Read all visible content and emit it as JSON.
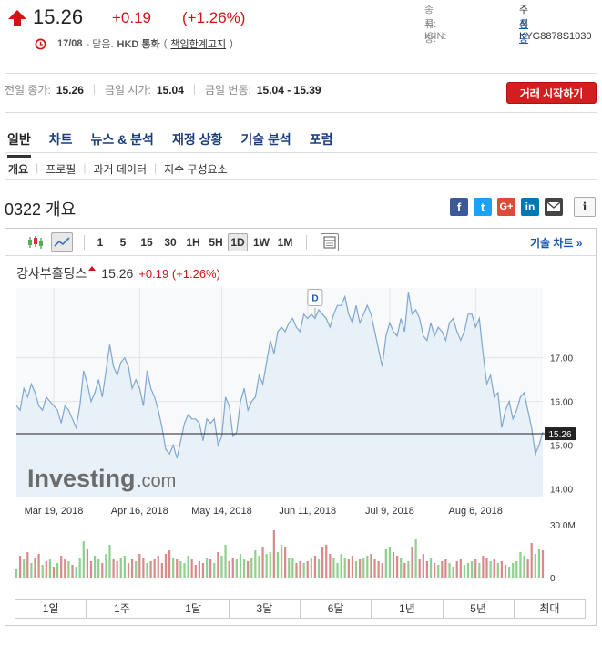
{
  "quote": {
    "price": "15.26",
    "change": "+0.19",
    "change_pct": "(+1.26%)",
    "date": "17/08",
    "status": "- 닫음.",
    "currency": "HKD 통화",
    "disclaimer": "책임한계고지",
    "disclaimer_open": "(",
    "disclaimer_close": ")"
  },
  "info": {
    "type_label": "종류:",
    "type_value": "주식",
    "market_label": "시장:",
    "market_value": "홍콩",
    "isin_label": "ISIN:",
    "isin_value": "KYG8878S1030"
  },
  "summary": {
    "prev_close_label": "전일 종가:",
    "prev_close": "15.26",
    "open_label": "금일 시가:",
    "open": "15.04",
    "range_label": "금일 변동:",
    "range": "15.04 - 15.39"
  },
  "trade_button": "거래 시작하기",
  "tabs": [
    "일반",
    "차트",
    "뉴스 & 분석",
    "재정 상황",
    "기술 분석",
    "포럼"
  ],
  "subtabs": [
    "개요",
    "프로필",
    "과거 데이터",
    "지수 구성요소"
  ],
  "section_title": "0322 개요",
  "share": {
    "fb": "f",
    "tw": "t",
    "gp": "G+",
    "li": "in",
    "info": "i"
  },
  "toolbar": {
    "intervals": [
      "1",
      "5",
      "15",
      "30",
      "1H",
      "5H",
      "1D",
      "1W",
      "1M"
    ],
    "selected": "1D",
    "tech_link": "기술 차트 »"
  },
  "chart_title": {
    "name": "강사부홀딩스",
    "price": "15.26",
    "change": "+0.19 (+1.26%)"
  },
  "watermark": {
    "brand": "Investing",
    "suffix": ".com"
  },
  "marker": "D",
  "ranges": [
    "1일",
    "1주",
    "1달",
    "3달",
    "6달",
    "1년",
    "5년",
    "최대"
  ],
  "chart_data": {
    "type": "area",
    "title": "강사부홀딩스",
    "last_value": 15.26,
    "y_ticks": [
      17.0,
      16.0,
      15.0,
      14.0
    ],
    "y_tick_labels": [
      "17.00",
      "16.00",
      "15.00",
      "14.00"
    ],
    "ylim": [
      13.8,
      18.6
    ],
    "x_labels": [
      "Mar 19, 2018",
      "Apr 16, 2018",
      "May 14, 2018",
      "Jun 11, 2018",
      "Jul 9, 2018",
      "Aug 6, 2018"
    ],
    "values": [
      15.9,
      15.8,
      16.3,
      16.1,
      16.4,
      16.2,
      15.9,
      15.8,
      16.1,
      16.0,
      15.9,
      15.8,
      15.5,
      15.9,
      15.8,
      15.6,
      15.4,
      15.9,
      16.7,
      16.4,
      16.0,
      16.2,
      16.5,
      16.1,
      16.7,
      17.3,
      16.8,
      16.6,
      16.9,
      17.0,
      16.8,
      16.3,
      16.5,
      16.3,
      15.9,
      16.7,
      16.3,
      16.1,
      15.8,
      15.4,
      14.9,
      14.8,
      15.0,
      14.7,
      15.1,
      15.5,
      15.7,
      15.6,
      15.6,
      15.5,
      15.1,
      15.6,
      15.5,
      15.6,
      15.0,
      15.2,
      16.1,
      15.9,
      15.2,
      15.3,
      16.0,
      16.3,
      15.8,
      16.0,
      16.1,
      16.6,
      16.4,
      16.9,
      17.4,
      17.1,
      17.6,
      17.7,
      17.6,
      17.8,
      17.9,
      17.7,
      17.6,
      18.0,
      17.9,
      18.0,
      17.9,
      18.1,
      18.0,
      17.9,
      17.7,
      18.0,
      18.2,
      18.2,
      18.4,
      18.0,
      17.8,
      18.2,
      17.8,
      18.0,
      18.2,
      18.0,
      17.6,
      17.2,
      16.8,
      17.5,
      17.8,
      17.6,
      17.5,
      17.9,
      17.6,
      18.5,
      18.0,
      18.1,
      17.9,
      17.5,
      17.4,
      17.8,
      17.5,
      17.7,
      17.6,
      17.4,
      17.8,
      17.9,
      17.6,
      17.4,
      17.6,
      18.0,
      18.0,
      17.7,
      17.9,
      17.1,
      16.4,
      16.6,
      16.1,
      16.2,
      15.4,
      15.8,
      16.0,
      15.6,
      15.8,
      16.1,
      16.2,
      15.8,
      15.4,
      14.8,
      15.0,
      15.3
    ],
    "volume_label": "30.0M",
    "volume_zero": "0",
    "volume": [
      5,
      12,
      10,
      14,
      8,
      11,
      13,
      7,
      9,
      10,
      6,
      8,
      12,
      10,
      9,
      7,
      6,
      11,
      20,
      16,
      9,
      12,
      10,
      8,
      13,
      18,
      10,
      9,
      11,
      12,
      8,
      10,
      9,
      13,
      11,
      8,
      9,
      10,
      12,
      8,
      13,
      15,
      11,
      10,
      9,
      8,
      12,
      10,
      7,
      9,
      8,
      11,
      10,
      8,
      14,
      12,
      18,
      9,
      11,
      10,
      13,
      10,
      9,
      11,
      15,
      12,
      17,
      13,
      14,
      26,
      14,
      18,
      17,
      11,
      11,
      8,
      9,
      8,
      9,
      11,
      12,
      10,
      17,
      18,
      13,
      11,
      8,
      13,
      11,
      10,
      12,
      9,
      10,
      11,
      12,
      13,
      10,
      9,
      8,
      16,
      17,
      14,
      12,
      11,
      8,
      9,
      17,
      21,
      10,
      13,
      9,
      11,
      8,
      7,
      9,
      10,
      8,
      6,
      9,
      10,
      7,
      8,
      9,
      10,
      8,
      12,
      11,
      9,
      10,
      8,
      9,
      7,
      6,
      8,
      9,
      14,
      12,
      10,
      19,
      13,
      16,
      15
    ],
    "volume_up": [
      1,
      0,
      1,
      0,
      1,
      0,
      0,
      1,
      0,
      1,
      0,
      1,
      0,
      0,
      1,
      0,
      1,
      1,
      1,
      0,
      0,
      1,
      1,
      0,
      1,
      1,
      0,
      0,
      1,
      1,
      0,
      0,
      1,
      0,
      0,
      1,
      0,
      0,
      0,
      0,
      0,
      0,
      1,
      0,
      1,
      1,
      1,
      0,
      0,
      0,
      0,
      1,
      0,
      1,
      0,
      1,
      1,
      0,
      0,
      1,
      1,
      1,
      0,
      1,
      1,
      1,
      0,
      1,
      1,
      0,
      1,
      1,
      0,
      1,
      1,
      0,
      0,
      1,
      0,
      1,
      0,
      1,
      0,
      0,
      0,
      1,
      1,
      1,
      1,
      0,
      0,
      1,
      0,
      1,
      1,
      0,
      0,
      0,
      0,
      1,
      1,
      0,
      0,
      1,
      0,
      1,
      0,
      1,
      0,
      0,
      0,
      1,
      0,
      1,
      0,
      0,
      1,
      1,
      0,
      0,
      1,
      1,
      1,
      0,
      1,
      0,
      0,
      1,
      0,
      1,
      0,
      0,
      1,
      1,
      1,
      1,
      1,
      0,
      0,
      1,
      1
    ]
  },
  "colors": {
    "up": "#d21414",
    "accent_blue": "#1a56a8",
    "line": "#7fa7d1",
    "area": "#e8f0f8",
    "vol_up": "#8fcf8f",
    "vol_down": "#d98a8a",
    "fb": "#3b5998",
    "tw": "#1da1f2",
    "gp": "#dd4b39",
    "li": "#0077b5",
    "mail": "#444"
  }
}
